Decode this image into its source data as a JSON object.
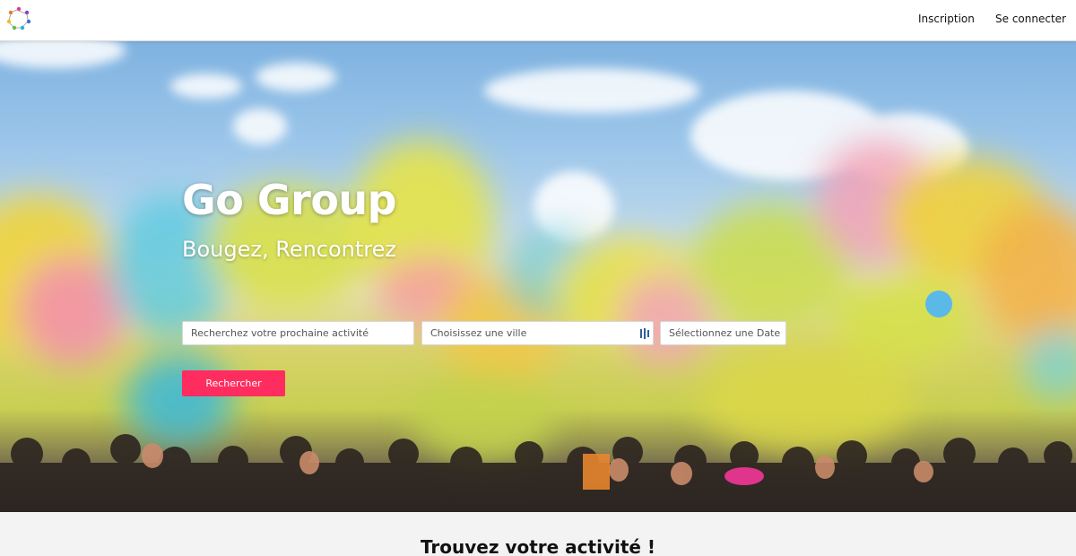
{
  "header": {
    "logo_icon": "colorful-people-circle-logo",
    "nav": {
      "signup_label": "Inscription",
      "login_label": "Se connecter"
    }
  },
  "hero": {
    "title": "Go Group",
    "subtitle": "Bougez, Rencontrez",
    "search": {
      "activity_placeholder": "Recherchez votre prochaine activité",
      "city_placeholder": "Choisissez une ville",
      "city_icon": "map-icon",
      "date_placeholder": "Sélectionnez une Date",
      "submit_label": "Rechercher"
    }
  },
  "section": {
    "title": "Trouvez votre activité !"
  },
  "colors": {
    "accent": "#ff2d5f",
    "topbar_bg": "#ffffff",
    "section_bg": "#f3f3f3"
  }
}
